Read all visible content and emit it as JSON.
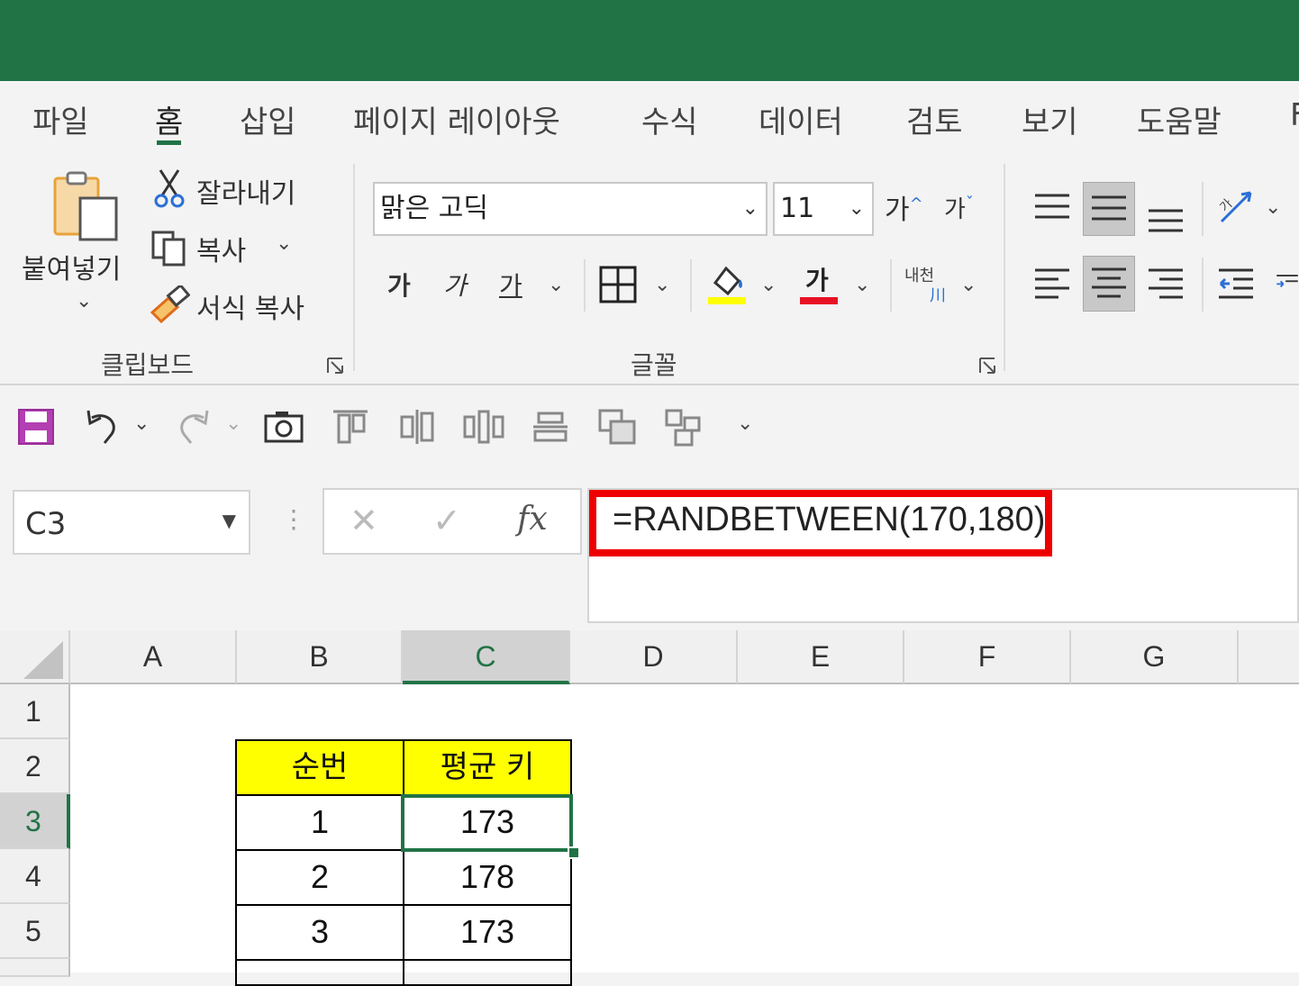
{
  "tabs": [
    "파일",
    "홈",
    "삽입",
    "페이지 레이아웃",
    "수식",
    "데이터",
    "검토",
    "보기",
    "도움말"
  ],
  "active_tab": "홈",
  "clipboard": {
    "paste_label": "붙여넣기",
    "cut_label": "잘라내기",
    "copy_label": "복사",
    "format_painter_label": "서식 복사",
    "group_label": "클립보드"
  },
  "font": {
    "name": "맑은 고딕",
    "size": "11",
    "grow_label": "가",
    "shrink_label": "가",
    "bold_label": "가",
    "italic_label": "가",
    "underline_label": "가",
    "font_color_label": "가",
    "phonetic_label": "내천",
    "group_label": "글꼴",
    "fill_color": "#ffff00",
    "font_color": "#e81123"
  },
  "name_box": {
    "value": "C3"
  },
  "formula_bar": {
    "fx_label": "fx",
    "formula": "=RANDBETWEEN(170,180)"
  },
  "columns": [
    "A",
    "B",
    "C",
    "D",
    "E",
    "F",
    "G"
  ],
  "selected_column": "C",
  "rows": [
    "1",
    "2",
    "3",
    "4",
    "5"
  ],
  "selected_row": "3",
  "table": {
    "headers": [
      "순번",
      "평균 키"
    ],
    "rows": [
      [
        "1",
        "173"
      ],
      [
        "2",
        "178"
      ],
      [
        "3",
        "173"
      ]
    ]
  },
  "colors": {
    "excel_green": "#217346",
    "highlight_red": "#ee0000"
  }
}
